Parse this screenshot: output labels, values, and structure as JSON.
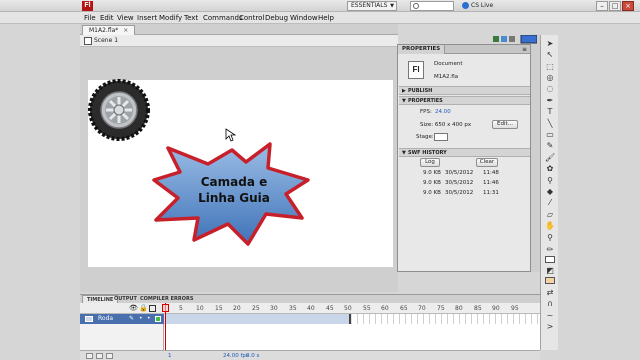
{
  "app": {
    "logo": "Fl",
    "workspace": "ESSENTIALS",
    "cs_live": "CS Live",
    "window_controls": [
      "–",
      "□",
      "×"
    ]
  },
  "menu": [
    "File",
    "Edit",
    "View",
    "Insert",
    "Modify",
    "Text",
    "Commands",
    "Control",
    "Debug",
    "Window",
    "Help"
  ],
  "document": {
    "tab_label": "M1A2.fla*",
    "close_glyph": "×",
    "scene_label": "Scene 1"
  },
  "stage": {
    "text_line1": "Camada e",
    "text_line2": "Linha Guia"
  },
  "properties": {
    "tab_label": "PROPERTIES",
    "doc_icon": "Fl",
    "doc_type": "Document",
    "doc_name": "M1A2.fla",
    "publish_label": "PUBLISH",
    "properties_label": "PROPERTIES",
    "fps_label": "FPS:",
    "fps_value": "24.00",
    "size_label": "Size: 650 x 400 px",
    "edit_button": "Edit...",
    "stage_label": "Stage:",
    "swf_history_label": "SWF HISTORY",
    "log_button": "Log",
    "clear_button": "Clear",
    "history": [
      {
        "size": "9.0 KB",
        "date": "30/5/2012",
        "time": "11:48"
      },
      {
        "size": "9.0 KB",
        "date": "30/5/2012",
        "time": "11:46"
      },
      {
        "size": "9.0 KB",
        "date": "30/5/2012",
        "time": "11:31"
      }
    ]
  },
  "timeline": {
    "tabs": [
      "TIMELINE",
      "OUTPUT",
      "COMPILER ERRORS"
    ],
    "ruler": [
      "5",
      "10",
      "15",
      "20",
      "25",
      "30",
      "35",
      "40",
      "45",
      "50",
      "55",
      "60",
      "65",
      "70",
      "75",
      "80",
      "85",
      "90",
      "95"
    ],
    "layer_name": "Roda",
    "frame_rate": "24.00 fps",
    "elapsed": "0.0 s",
    "current_frame": "1"
  },
  "colors": {
    "star_fill_top": "#9bbde6",
    "star_fill_bottom": "#3f73b8",
    "star_stroke": "#c8202a",
    "accent_blue": "#1c5bb8",
    "selected_layer": "#4a6fae",
    "playhead": "#d40000"
  }
}
